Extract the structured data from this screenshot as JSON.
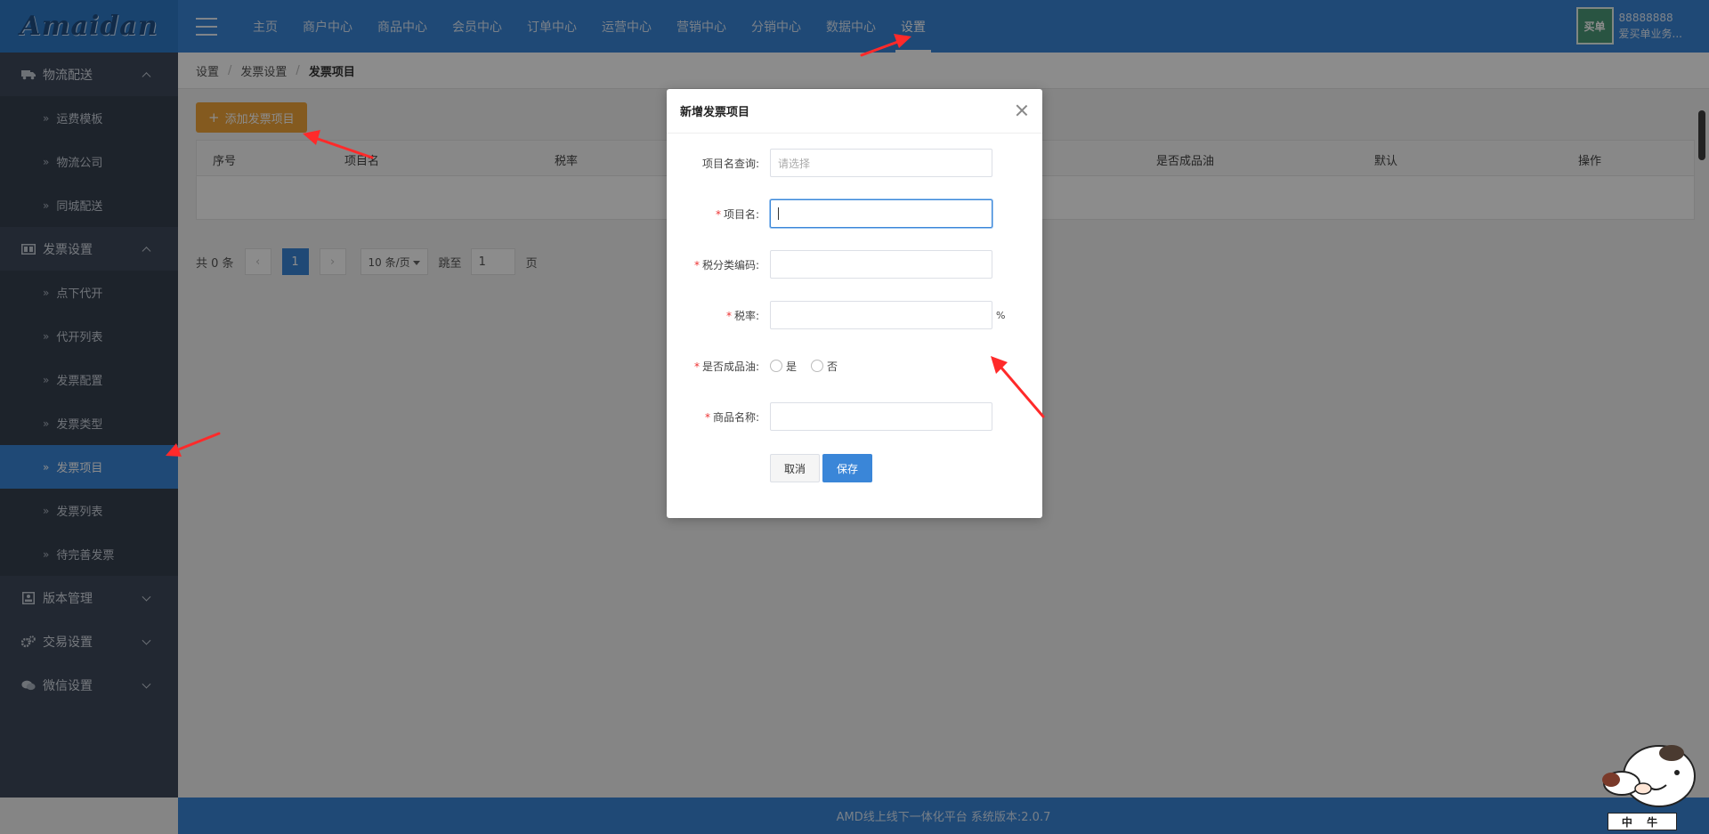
{
  "app": {
    "logo_text": "Amaidan",
    "footer_text": "AMD线上线下一体化平台 系统版本:2.0.7"
  },
  "topnav": {
    "items": [
      {
        "label": "主页"
      },
      {
        "label": "商户中心"
      },
      {
        "label": "商品中心"
      },
      {
        "label": "会员中心"
      },
      {
        "label": "订单中心"
      },
      {
        "label": "运营中心"
      },
      {
        "label": "营销中心"
      },
      {
        "label": "分销中心"
      },
      {
        "label": "数据中心"
      },
      {
        "label": "设置"
      }
    ],
    "active_index": 9
  },
  "user": {
    "avatar_text": "买单",
    "id": "88888888",
    "name": "爱买单业务..."
  },
  "sidebar": {
    "groups": [
      {
        "label": "物流配送",
        "icon": "truck-icon",
        "expanded": true,
        "items": [
          "运费模板",
          "物流公司",
          "同城配送"
        ]
      },
      {
        "label": "发票设置",
        "icon": "invoice-icon",
        "expanded": true,
        "items": [
          "点下代开",
          "代开列表",
          "发票配置",
          "发票类型",
          "发票项目",
          "发票列表",
          "待完善发票"
        ]
      },
      {
        "label": "版本管理",
        "icon": "version-icon",
        "expanded": false,
        "items": []
      },
      {
        "label": "交易设置",
        "icon": "gears-icon",
        "expanded": false,
        "items": []
      },
      {
        "label": "微信设置",
        "icon": "wechat-icon",
        "expanded": false,
        "items": []
      }
    ],
    "active_item": "发票项目"
  },
  "breadcrumb": [
    "设置",
    "发票设置",
    "发票项目"
  ],
  "toolbar": {
    "add_label": "添加发票项目"
  },
  "table": {
    "columns": [
      "序号",
      "项目名",
      "税率",
      "是否成品油",
      "默认",
      "操作"
    ],
    "rows": []
  },
  "pager": {
    "total_text": "共 0 条",
    "current_page": "1",
    "page_size": "10 条/页",
    "goto_label": "跳至",
    "goto_value": "1",
    "page_unit": "页"
  },
  "modal": {
    "title": "新增发票项目",
    "fields": {
      "query": {
        "label": "项目名查询:",
        "placeholder": "请选择"
      },
      "name": {
        "label": "项目名:"
      },
      "tax_code": {
        "label": "税分类编码:"
      },
      "tax_rate": {
        "label": "税率:",
        "unit": "%"
      },
      "is_oil": {
        "label": "是否成品油:",
        "options": [
          "是",
          "否"
        ]
      },
      "goods_name": {
        "label": "商品名称:"
      }
    },
    "cancel_label": "取消",
    "save_label": "保存"
  },
  "mascot": {
    "label": "中 牛"
  },
  "colors": {
    "primary": "#3a86d8",
    "sidebar": "#3f4a5b",
    "add_button": "#f0a53a",
    "annotation": "#ff2a2a"
  }
}
